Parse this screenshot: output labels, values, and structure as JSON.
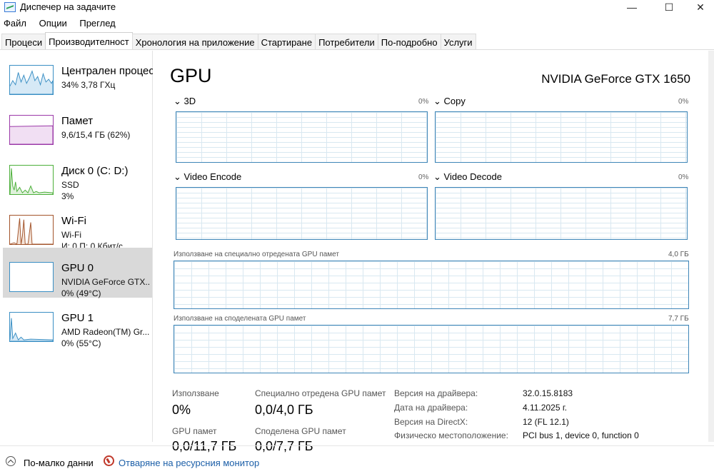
{
  "window": {
    "title": "Диспечер на задачите",
    "min_label": "—",
    "max_label": "☐",
    "close_label": "✕"
  },
  "menu": [
    "Файл",
    "Опции",
    "Преглед"
  ],
  "tabs": [
    "Процеси",
    "Производителност",
    "Хронология на приложение",
    "Стартиране",
    "Потребители",
    "По-подробно",
    "Услуги"
  ],
  "active_tab": "Производителност",
  "sidebar": [
    {
      "title": "Централен процесор",
      "sub1": "34%  3,78 ГХц",
      "sub2": "",
      "color": "#3a8fc4"
    },
    {
      "title": "Памет",
      "sub1": "9,6/15,4 ГБ (62%)",
      "sub2": "",
      "color": "#9b39a8"
    },
    {
      "title": "Диск 0 (C: D:)",
      "sub1": "SSD",
      "sub2": "3%",
      "color": "#4caf3a"
    },
    {
      "title": "Wi-Fi",
      "sub1": "Wi-Fi",
      "sub2": "И: 0  П: 0 Кбит/с",
      "color": "#a3542b"
    },
    {
      "title": "GPU 0",
      "sub1": "NVIDIA GeForce GTX...",
      "sub2": "0% (49°C)",
      "color": "#3a8fc4"
    },
    {
      "title": "GPU 1",
      "sub1": "AMD Radeon(TM) Gr...",
      "sub2": "0% (55°C)",
      "color": "#3a8fc4"
    }
  ],
  "main": {
    "title": "GPU",
    "gpu_name": "NVIDIA GeForce GTX 1650",
    "engines": [
      {
        "label": "3D",
        "pct": "0%"
      },
      {
        "label": "Copy",
        "pct": "0%"
      },
      {
        "label": "Video Encode",
        "pct": "0%"
      },
      {
        "label": "Video Decode",
        "pct": "0%"
      }
    ],
    "dedicated_label": "Използване на специално отредената GPU памет",
    "dedicated_max": "4,0 ГБ",
    "shared_label": "Използване на споделената GPU памет",
    "shared_max": "7,7 ГБ",
    "stats": {
      "usage_label": "Използване",
      "usage_value": "0%",
      "dedicated_label": "Специално отредена GPU памет",
      "dedicated_value": "0,0/4,0 ГБ",
      "gpu_mem_label": "GPU памет",
      "gpu_mem_value": "0,0/11,7 ГБ",
      "shared_label": "Споделена GPU памет",
      "shared_value": "0,0/7,7 ГБ"
    },
    "info": [
      {
        "label": "Версия на драйвера:",
        "value": "32.0.15.8183"
      },
      {
        "label": "Дата на драйвера:",
        "value": "4.11.2025 г."
      },
      {
        "label": "Версия на DirectX:",
        "value": "12 (FL 12.1)"
      },
      {
        "label": "Физическо местоположение:",
        "value": "PCI bus 1, device 0, function 0"
      }
    ]
  },
  "footer": {
    "fewer": "По-малко данни",
    "resmon": "Отваряне на ресурсния монитор"
  }
}
